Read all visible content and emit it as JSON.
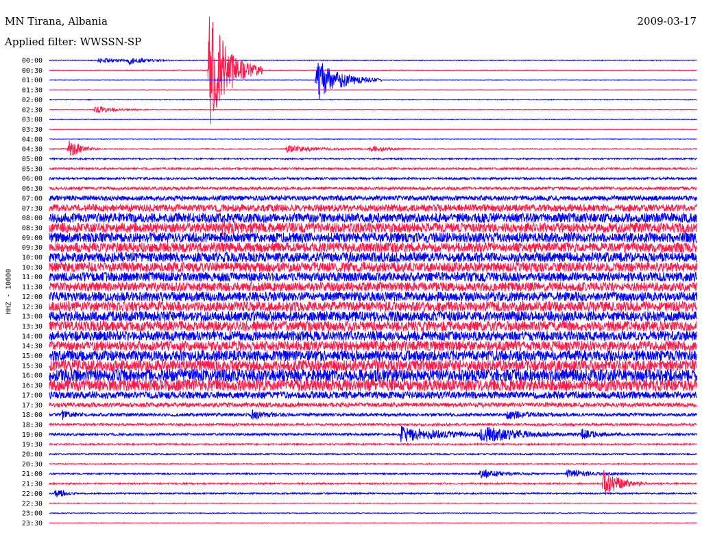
{
  "header": {
    "station": "MN Tirana, Albania",
    "date": "2009-03-17",
    "filter": "Applied filter: WWSSN-SP",
    "channel": "HHZ - 10000"
  },
  "colors": {
    "even_trace": "#0000ff",
    "odd_trace": "#ff1a4a",
    "background": "#ffffff",
    "text": "#000000"
  },
  "chart_data": {
    "type": "line",
    "title": "MN Tirana, Albania",
    "subtitle": "Applied filter: WWSSN-SP",
    "date": "2009-03-17",
    "ylabel": "HHZ - 10000",
    "row_labels": [
      "00:00",
      "00:30",
      "01:00",
      "01:30",
      "02:00",
      "02:30",
      "03:00",
      "03:30",
      "04:00",
      "04:30",
      "05:00",
      "05:30",
      "06:00",
      "06:30",
      "07:00",
      "07:30",
      "08:00",
      "08:30",
      "09:00",
      "09:30",
      "10:00",
      "10:30",
      "11:00",
      "11:30",
      "12:00",
      "12:30",
      "13:00",
      "13:30",
      "14:00",
      "14:30",
      "15:00",
      "15:30",
      "16:00",
      "16:30",
      "17:00",
      "17:30",
      "18:00",
      "18:30",
      "19:00",
      "19:30",
      "20:00",
      "20:30",
      "21:00",
      "21:30",
      "22:00",
      "22:30",
      "23:00",
      "23:30"
    ],
    "minutes_per_row": 30,
    "noise_level": [
      0.5,
      0.4,
      0.4,
      0.3,
      0.5,
      0.4,
      0.4,
      0.4,
      0.5,
      0.6,
      1.0,
      1.4,
      1.6,
      2.2,
      3.6,
      5.2,
      6.8,
      7.0,
      7.2,
      7.0,
      7.0,
      7.0,
      6.6,
      6.4,
      6.8,
      7.2,
      7.2,
      7.4,
      7.0,
      7.2,
      7.6,
      8.2,
      9.0,
      8.6,
      5.2,
      3.2,
      2.2,
      1.8,
      1.6,
      1.2,
      0.9,
      0.9,
      1.0,
      1.2,
      1.0,
      0.6,
      0.5,
      0.5
    ],
    "events": [
      {
        "row": 0,
        "minute": 2.3,
        "amplitude": 4,
        "duration": 3
      },
      {
        "row": 0,
        "minute": 3.7,
        "amplitude": 5,
        "duration": 2
      },
      {
        "row": 1,
        "minute": 7.4,
        "amplitude": 90,
        "duration": 2.5
      },
      {
        "row": 2,
        "minute": 12.4,
        "amplitude": 32,
        "duration": 3
      },
      {
        "row": 5,
        "minute": 2.1,
        "amplitude": 6,
        "duration": 2.5
      },
      {
        "row": 9,
        "minute": 0.9,
        "amplitude": 14,
        "duration": 1.5
      },
      {
        "row": 9,
        "minute": 11.0,
        "amplitude": 5,
        "duration": 4
      },
      {
        "row": 9,
        "minute": 14.9,
        "amplitude": 5,
        "duration": 2
      },
      {
        "row": 17,
        "minute": 8.0,
        "amplitude": 6,
        "duration": 2
      },
      {
        "row": 36,
        "minute": 0.6,
        "amplitude": 6,
        "duration": 1
      },
      {
        "row": 36,
        "minute": 9.4,
        "amplitude": 6,
        "duration": 1.5
      },
      {
        "row": 36,
        "minute": 21.2,
        "amplitude": 5,
        "duration": 3
      },
      {
        "row": 38,
        "minute": 16.3,
        "amplitude": 10,
        "duration": 6
      },
      {
        "row": 38,
        "minute": 20.0,
        "amplitude": 10,
        "duration": 5
      },
      {
        "row": 38,
        "minute": 24.7,
        "amplitude": 6,
        "duration": 2
      },
      {
        "row": 42,
        "minute": 20.0,
        "amplitude": 6,
        "duration": 3
      },
      {
        "row": 42,
        "minute": 24.0,
        "amplitude": 6,
        "duration": 3
      },
      {
        "row": 43,
        "minute": 25.7,
        "amplitude": 20,
        "duration": 2
      },
      {
        "row": 44,
        "minute": 0.3,
        "amplitude": 8,
        "duration": 1
      }
    ]
  }
}
